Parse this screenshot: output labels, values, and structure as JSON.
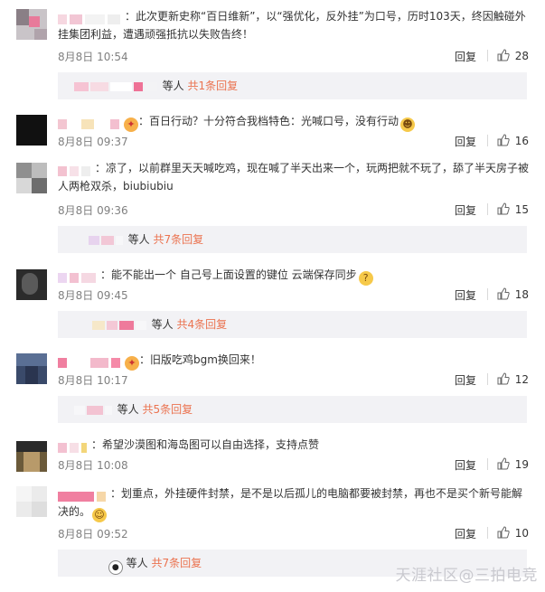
{
  "comments": [
    {
      "text": "：此次更新史称“百日维新”，以“强优化，反外挂”为口号，历时103天，终因触碰外挂集团利益，遭遇顽强抵抗以失败告终！",
      "time": "8月8日 10:54",
      "reply_label": "回复",
      "likes": "28",
      "replies_suffix": "等人",
      "replies_link": "共1条回复"
    },
    {
      "text": "：百日行动？十分符合我档特色：光喊口号，没有行动",
      "emoji": "grin-emoji",
      "time": "8月8日 09:37",
      "reply_label": "回复",
      "likes": "16"
    },
    {
      "text": "：凉了，以前群里天天喊吃鸡，现在喊了半天出来一个，玩两把就不玩了，舔了半天房子被人两枪双杀，biubiubiu",
      "time": "8月8日 09:36",
      "reply_label": "回复",
      "likes": "15",
      "replies_suffix": "等人",
      "replies_link": "共7条回复"
    },
    {
      "text": "：能不能出一个 自己号上面设置的键位 云端保存同步",
      "emoji": "thinking-emoji",
      "time": "8月8日 09:45",
      "reply_label": "回复",
      "likes": "18",
      "replies_suffix": "等人",
      "replies_link": "共4条回复"
    },
    {
      "text": "：旧版吃鸡bgm换回来！",
      "time": "8月8日 10:17",
      "reply_label": "回复",
      "likes": "12",
      "replies_suffix": "等人",
      "replies_link": "共5条回复"
    },
    {
      "text": "：希望沙漠图和海岛图可以自由选择，支持点赞",
      "time": "8月8日 10:08",
      "reply_label": "回复",
      "likes": "19"
    },
    {
      "text": "：划重点，外挂硬件封禁，是不是以后孤儿的电脑都要被封禁，再也不是买个新号能解决的。",
      "emoji": "smile-emoji",
      "time": "8月8日 09:52",
      "reply_label": "回复",
      "likes": "10",
      "replies_suffix": "等人",
      "replies_link": "共7条回复"
    }
  ],
  "watermark": "天涯社区@三拍电竞",
  "colors": {
    "accent": "#eb7350",
    "meta": "#808080",
    "reply_bg": "#f2f2f5"
  }
}
